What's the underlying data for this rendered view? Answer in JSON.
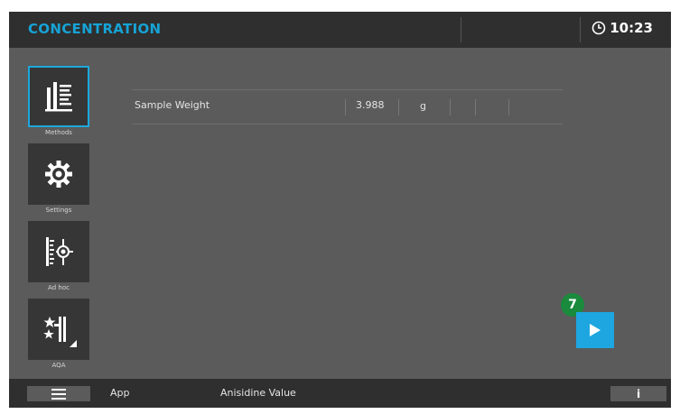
{
  "header": {
    "title": "CONCENTRATION",
    "time": "10:23"
  },
  "sidebar": {
    "items": [
      {
        "label": "Methods",
        "icon": "methods-icon",
        "active": true
      },
      {
        "label": "Settings",
        "icon": "gear-icon",
        "active": false
      },
      {
        "label": "Ad hoc",
        "icon": "ad-hoc-icon",
        "active": false
      },
      {
        "label": "AQA",
        "icon": "aqa-icon",
        "active": false
      }
    ]
  },
  "main": {
    "rows": [
      {
        "label": "Sample Weight",
        "value": "3.988",
        "unit": "g"
      }
    ]
  },
  "callout": {
    "number": "7"
  },
  "footer": {
    "app_label": "App",
    "method_name": "Anisidine Value",
    "info_label": "i"
  },
  "colors": {
    "accent": "#1ea6e0",
    "title": "#16a3d6",
    "badge": "#1a8a3d",
    "background": "#5b5b5b",
    "bar": "#2f2f2f"
  }
}
